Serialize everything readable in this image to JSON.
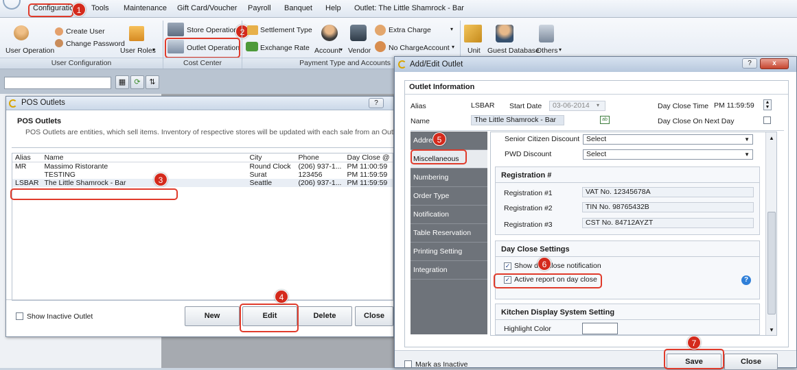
{
  "menubar": {
    "items": [
      "Configuration",
      "Tools",
      "Maintenance",
      "Gift Card/Voucher",
      "Payroll",
      "Banquet",
      "Help",
      "Outlet: The Little Shamrock - Bar"
    ]
  },
  "ribbon": {
    "user_config": {
      "user_operation": "User Operation",
      "create_user": "Create User",
      "change_password": "Change Password",
      "user_roles": "User Roles",
      "caption": "User Configuration"
    },
    "cost_center": {
      "store_operation": "Store Operation",
      "outlet_operation": "Outlet Operation",
      "caption": "Cost Center"
    },
    "payment": {
      "settlement_type": "Settlement Type",
      "exchange_rate": "Exchange Rate",
      "account": "Account",
      "vendor": "Vendor",
      "extra_charge": "Extra Charge",
      "no_charge_account": "No ChargeAccount",
      "caption": "Payment Type and Accounts"
    },
    "others": {
      "unit": "Unit",
      "guest_database": "Guest Database",
      "others": "Others"
    }
  },
  "pos_window": {
    "title": "POS Outlets",
    "heading": "POS Outlets",
    "description": "POS Outlets are entities, which sell items. Inventory of respective stores will be updated with each sale from an Outlet.",
    "columns": [
      "Alias",
      "Name",
      "City",
      "Phone",
      "Day Close @"
    ],
    "rows": [
      {
        "alias": "MR",
        "name": "Massimo Ristorante",
        "city": "Round Clock",
        "phone": "(206) 937-1...",
        "day_close": "PM 11:00:59"
      },
      {
        "alias": "",
        "name": "TESTING",
        "city": "Surat",
        "phone": "123456",
        "day_close": "PM 11:59:59"
      },
      {
        "alias": "LSBAR",
        "name": "The Little Shamrock - Bar",
        "city": "Seattle",
        "phone": "(206) 937-1...",
        "day_close": "PM 11:59:59"
      }
    ],
    "show_inactive": "Show Inactive Outlet",
    "buttons": {
      "new": "New",
      "edit": "Edit",
      "delete": "Delete",
      "close": "Close"
    },
    "help": "?"
  },
  "edit_window": {
    "title": "Add/Edit Outlet",
    "help": "?",
    "close_x": "x",
    "outlet_info": {
      "heading": "Outlet Information",
      "alias_label": "Alias",
      "alias_value": "LSBAR",
      "start_date_label": "Start Date",
      "start_date_value": "03-06-2014",
      "day_close_time_label": "Day Close Time",
      "day_close_time_value": "PM 11:59:59",
      "name_label": "Name",
      "name_value": "The Little Shamrock - Bar",
      "day_close_next_label": "Day Close On Next Day"
    },
    "tabs": [
      "Address",
      "Miscellaneous",
      "Numbering",
      "Order Type",
      "Notification",
      "Table Reservation",
      "Printing Setting",
      "Integration"
    ],
    "discounts": {
      "senior_label": "Senior Citizen Discount",
      "senior_value": "Select",
      "pwd_label": "PWD Discount",
      "pwd_value": "Select"
    },
    "registration": {
      "heading": "Registration #",
      "items": [
        {
          "label": "Registration #1",
          "value": "VAT No. 12345678A"
        },
        {
          "label": "Registration #2",
          "value": "TIN No. 98765432B"
        },
        {
          "label": "Registration #3",
          "value": "CST No. 84712AYZT"
        }
      ]
    },
    "day_close": {
      "heading": "Day Close Settings",
      "show_notification": "Show day close notification",
      "active_report": "Active report on day close"
    },
    "kds": {
      "heading": "Kitchen Display System Setting",
      "highlight_label": "Highlight Color"
    },
    "mark_inactive": "Mark as Inactive",
    "buttons": {
      "save": "Save",
      "close": "Close"
    }
  },
  "callouts": [
    "1",
    "2",
    "3",
    "4",
    "5",
    "6",
    "7"
  ],
  "colors": {
    "callout": "#d42a1c",
    "tab_bg": "#6e737a",
    "selected_tab": "#e8ebef"
  }
}
